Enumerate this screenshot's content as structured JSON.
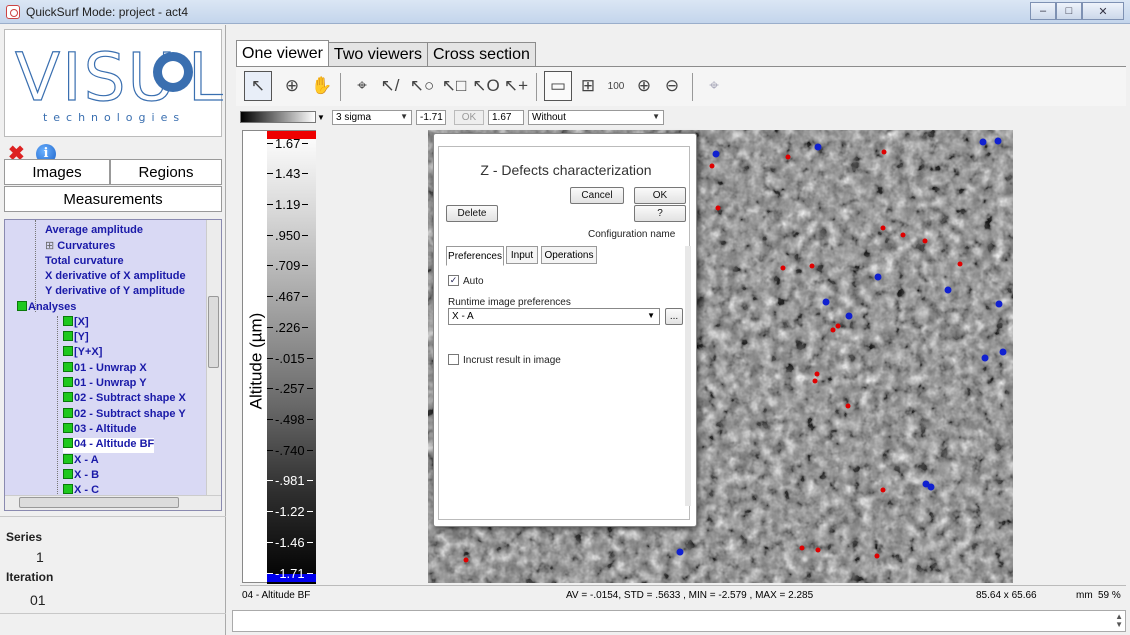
{
  "window": {
    "title": "QuickSurf Mode: project -  act4",
    "buttons": [
      "–",
      "□",
      "✕"
    ]
  },
  "logo": {
    "text": "VISU",
    "text2": "L",
    "subtitle": "technologies"
  },
  "left_panel": {
    "tabs": {
      "images": "Images",
      "regions": "Regions",
      "measurements": "Measurements"
    },
    "tree": [
      {
        "label": "Average amplitude",
        "indent": 1,
        "icon": "none"
      },
      {
        "label": "Curvatures",
        "indent": 1,
        "icon": "plus"
      },
      {
        "label": "Total curvature",
        "indent": 1,
        "icon": "none"
      },
      {
        "label": "X derivative of X amplitude",
        "indent": 1,
        "icon": "none"
      },
      {
        "label": "Y derivative of Y amplitude",
        "indent": 1,
        "icon": "none"
      },
      {
        "label": "Analyses",
        "indent": 0,
        "icon": "green"
      },
      {
        "label": "[X]",
        "indent": 2,
        "icon": "green"
      },
      {
        "label": "[Y]",
        "indent": 2,
        "icon": "green"
      },
      {
        "label": "[Y+X]",
        "indent": 2,
        "icon": "green"
      },
      {
        "label": "01 - Unwrap X",
        "indent": 2,
        "icon": "green"
      },
      {
        "label": "01 - Unwrap Y",
        "indent": 2,
        "icon": "green"
      },
      {
        "label": "02 - Subtract shape X",
        "indent": 2,
        "icon": "green"
      },
      {
        "label": "02 - Subtract shape Y",
        "indent": 2,
        "icon": "green"
      },
      {
        "label": "03 - Altitude",
        "indent": 2,
        "icon": "green"
      },
      {
        "label": "04 - Altitude BF",
        "indent": 2,
        "icon": "green",
        "selected": true
      },
      {
        "label": "X - A",
        "indent": 2,
        "icon": "green"
      },
      {
        "label": "X - B",
        "indent": 2,
        "icon": "green"
      },
      {
        "label": "X - C",
        "indent": 2,
        "icon": "green"
      }
    ],
    "series_label": "Series",
    "series_value": "1",
    "iteration_label": "Iteration",
    "iteration_value": "01"
  },
  "viewer_tabs": [
    "One viewer",
    "Two viewers",
    "Cross section"
  ],
  "toolbar_icons": [
    "select-arrow-icon",
    "measure-zoom-icon",
    "pan-hand-icon",
    "point-pick-icon",
    "line-profile-icon",
    "circle-select-icon",
    "rect-select-icon",
    "ellipse-select-icon",
    "add-point-icon",
    "fit-window-icon",
    "center-icon",
    "zoom-100-icon",
    "zoom-in-icon",
    "zoom-out-icon",
    "crosshair-icon"
  ],
  "toolbar": {
    "zoom100_label": "100"
  },
  "controls": {
    "sigma": "3 sigma",
    "min": "-1.71",
    "ok": "OK",
    "max": "1.67",
    "mode": "Without"
  },
  "scale": {
    "axis_label": "Altitude (µm)",
    "ticks": [
      "1.67",
      "1.43",
      "1.19",
      ".950",
      ".709",
      ".467",
      ".226",
      "-.015",
      "-.257",
      "-.498",
      "-.740",
      "-.981",
      "-1.22",
      "-1.46",
      "-1.71"
    ]
  },
  "dialog": {
    "title": "Z - Defects characterization",
    "cancel": "Cancel",
    "ok": "OK",
    "delete": "Delete",
    "help": "?",
    "config_name": "Configuration name",
    "tabs": [
      "Preferences",
      "Input",
      "Operations"
    ],
    "auto_label": "Auto",
    "auto_checked": true,
    "runtime_label": "Runtime image preferences",
    "runtime_value": "X - A",
    "browse": "...",
    "incrust_label": "Incrust result in image",
    "incrust_checked": false
  },
  "status": {
    "image_name": "04 - Altitude BF",
    "stats": "AV = -.0154, STD = .5633 , MIN = -2.579 , MAX = 2.285",
    "size": "85.64 x 65.66",
    "unit": "mm",
    "zoom": "59 %"
  },
  "colors": {
    "defect_red": "#e00000",
    "defect_blue": "#1020d0",
    "tree_text": "#1a1aa8",
    "tree_bg": "#d9d9f4"
  }
}
